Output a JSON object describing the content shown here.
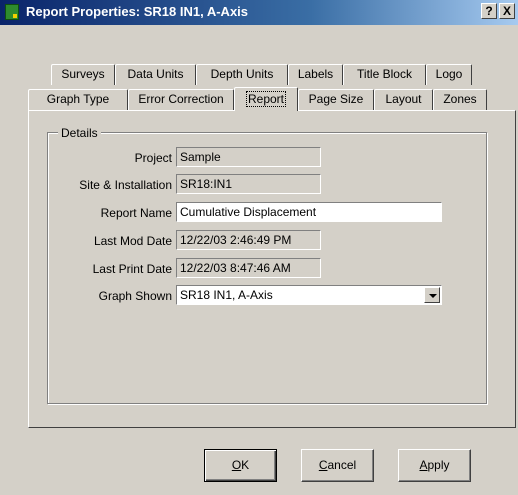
{
  "window": {
    "title": "Report Properties: SR18 IN1, A-Axis",
    "help_label": "?",
    "close_label": "X"
  },
  "tabs_back": [
    {
      "label": "Surveys"
    },
    {
      "label": "Data Units"
    },
    {
      "label": "Depth Units"
    },
    {
      "label": "Labels"
    },
    {
      "label": "Title Block"
    },
    {
      "label": "Logo"
    }
  ],
  "tabs_front": [
    {
      "label": "Graph Type"
    },
    {
      "label": "Error Correction"
    },
    {
      "label": "Report",
      "active": true
    },
    {
      "label": "Page Size"
    },
    {
      "label": "Layout"
    },
    {
      "label": "Zones"
    }
  ],
  "details": {
    "group_label": "Details",
    "project_label": "Project",
    "project_value": "Sample",
    "site_label": "Site & Installation",
    "site_value": "SR18:IN1",
    "report_name_label": "Report Name",
    "report_name_value": "Cumulative Displacement",
    "last_mod_label": "Last Mod Date",
    "last_mod_value": "12/22/03 2:46:49 PM",
    "last_print_label": "Last Print Date",
    "last_print_value": "12/22/03 8:47:46 AM",
    "graph_shown_label": "Graph Shown",
    "graph_shown_value": "SR18 IN1, A-Axis"
  },
  "buttons": {
    "ok_mnemonic": "O",
    "ok_rest": "K",
    "cancel_mnemonic": "C",
    "cancel_rest": "ancel",
    "apply_mnemonic": "A",
    "apply_rest": "pply"
  }
}
